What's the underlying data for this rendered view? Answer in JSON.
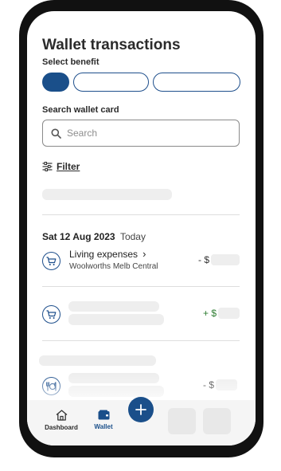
{
  "page": {
    "title": "Wallet transactions",
    "select_benefit_label": "Select benefit",
    "search_label": "Search wallet card"
  },
  "search": {
    "placeholder": "Search",
    "value": ""
  },
  "filter": {
    "label": "Filter"
  },
  "transactions_group": {
    "date": "Sat 12 Aug 2023",
    "relative": "Today"
  },
  "transactions": [
    {
      "title": "Living expenses",
      "merchant": "Woolworths Melb Central",
      "amount_prefix": "- $",
      "icon": "cart-icon"
    },
    {
      "title": "",
      "merchant": "",
      "amount_prefix": "+ $",
      "icon": "cart-icon"
    },
    {
      "title": "",
      "merchant": "",
      "amount_prefix": "- $",
      "icon": "restaurant-icon"
    }
  ],
  "tabbar": {
    "dashboard_label": "Dashboard",
    "wallet_label": "Wallet"
  },
  "colors": {
    "primary": "#1a4f8a",
    "positive": "#2e7d32",
    "skeleton": "#eeeeee"
  }
}
